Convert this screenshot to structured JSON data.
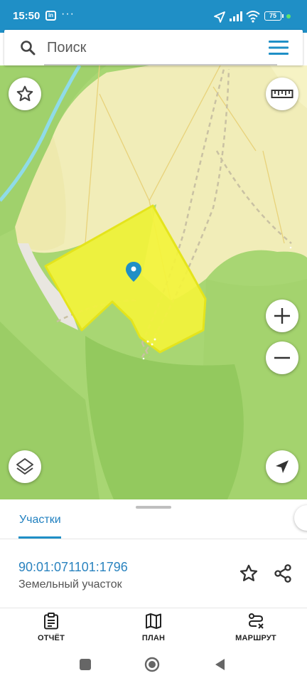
{
  "status_bar": {
    "time": "15:50",
    "app_icon_text": "in",
    "more": "···",
    "battery": "75"
  },
  "search": {
    "placeholder": "Поиск"
  },
  "map": {
    "icons": [
      "star-icon",
      "ruler-icon",
      "zoom-in-icon",
      "zoom-out-icon",
      "layers-icon",
      "location-arrow-icon",
      "map-pin-icon"
    ],
    "colors": {
      "forest": "#9fd36a",
      "meadow": "#f3efbc",
      "parcel_fill": "#f2f23a",
      "parcel_border": "#e5e520",
      "water": "#7fd4e0",
      "accent": "#1f8fc6"
    }
  },
  "sheet": {
    "tab_label": "Участки",
    "parcel": {
      "cadastral_number": "90:01:071101:1796",
      "type": "Земельный участок"
    }
  },
  "bottom_nav": [
    {
      "label": "ОТЧЁТ",
      "icon": "clipboard-icon"
    },
    {
      "label": "ПЛАН",
      "icon": "map-icon"
    },
    {
      "label": "МАРШРУТ",
      "icon": "route-icon"
    }
  ]
}
